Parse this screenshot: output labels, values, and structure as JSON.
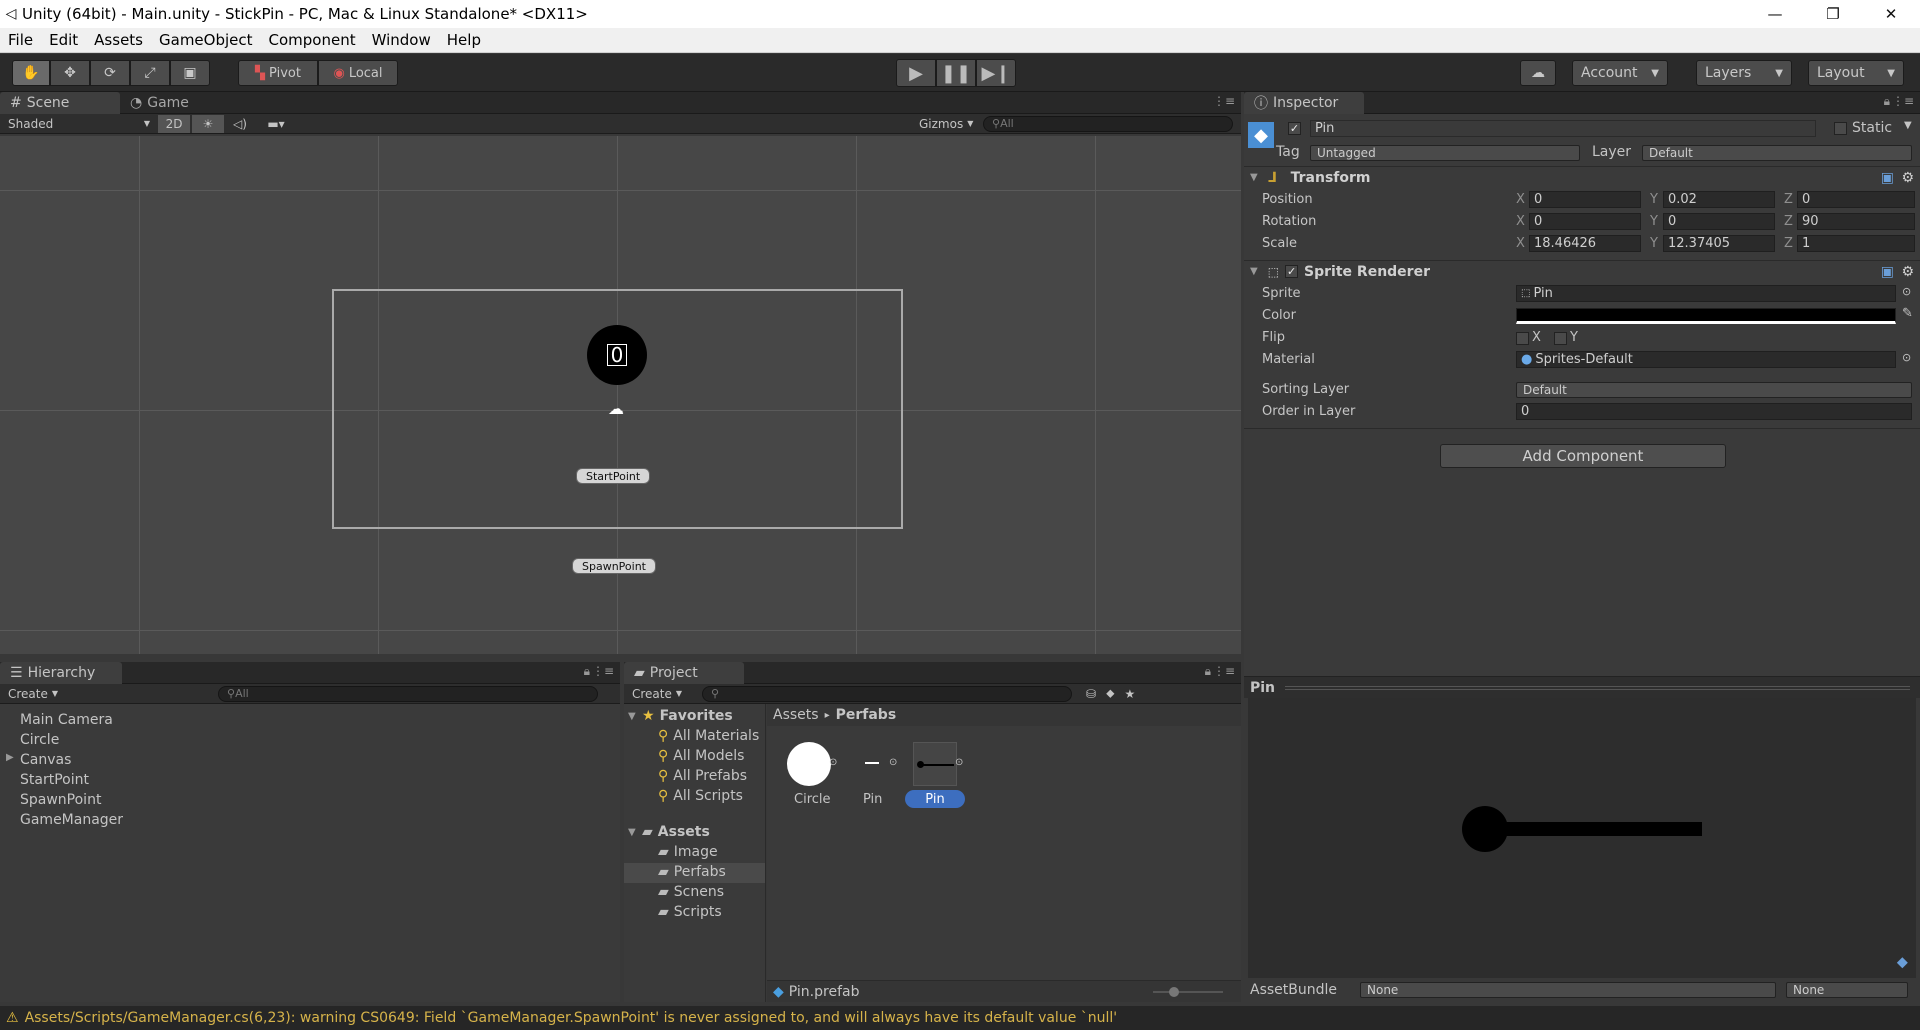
{
  "window": {
    "title": "Unity (64bit) - Main.unity - StickPin - PC, Mac & Linux Standalone* <DX11>",
    "minimize": "—",
    "restore": "❐",
    "close": "✕"
  },
  "menu": [
    "File",
    "Edit",
    "Assets",
    "GameObject",
    "Component",
    "Window",
    "Help"
  ],
  "toolbar": {
    "pivot": "Pivot",
    "local": "Local",
    "account": "Account",
    "layers": "Layers",
    "layout": "Layout"
  },
  "scene_panel": {
    "tabs": [
      "Scene",
      "Game"
    ],
    "shading": "Shaded",
    "mode_2d": "2D",
    "gizmos": "Gizmos",
    "search_placeholder": "All",
    "circle_number": "0",
    "labels": [
      "StartPoint",
      "SpawnPoint"
    ]
  },
  "inspector": {
    "tab": "Inspector",
    "object_name": "Pin",
    "static_label": "Static",
    "tag_label": "Tag",
    "tag_value": "Untagged",
    "layer_label": "Layer",
    "layer_value": "Default",
    "transform": {
      "title": "Transform",
      "rows": [
        {
          "label": "Position",
          "x": "0",
          "y": "0.02",
          "z": "0"
        },
        {
          "label": "Rotation",
          "x": "0",
          "y": "0",
          "z": "90"
        },
        {
          "label": "Scale",
          "x": "18.46426",
          "y": "12.37405",
          "z": "1"
        }
      ],
      "axis": [
        "X",
        "Y",
        "Z"
      ]
    },
    "sprite_renderer": {
      "title": "Sprite Renderer",
      "sprite_label": "Sprite",
      "sprite_value": "Pin",
      "color_label": "Color",
      "color_value": "#000000",
      "flip_label": "Flip",
      "flip_x": "X",
      "flip_y": "Y",
      "material_label": "Material",
      "material_value": "Sprites-Default",
      "sorting_layer_label": "Sorting Layer",
      "sorting_layer_value": "Default",
      "order_label": "Order in Layer",
      "order_value": "0"
    },
    "add_component": "Add Component",
    "preview_title": "Pin",
    "asset_bundle_label": "AssetBundle",
    "asset_bundle_value": "None",
    "asset_bundle_variant": "None"
  },
  "hierarchy": {
    "tab": "Hierarchy",
    "create": "Create",
    "search_placeholder": "All",
    "items": [
      "Main Camera",
      "Circle",
      "Canvas",
      "StartPoint",
      "SpawnPoint",
      "GameManager"
    ]
  },
  "project": {
    "tab": "Project",
    "create": "Create",
    "favorites_title": "Favorites",
    "favorites": [
      "All Materials",
      "All Models",
      "All Prefabs",
      "All Scripts"
    ],
    "assets_title": "Assets",
    "folders": [
      "Image",
      "Perfabs",
      "Scnens",
      "Scripts"
    ],
    "breadcrumb": [
      "Assets",
      "Perfabs"
    ],
    "breadcrumb_sep": "▸",
    "files": [
      "Circle",
      "Pin",
      "Pin"
    ],
    "selected_file": "Pin.prefab"
  },
  "status": {
    "message": "Assets/Scripts/GameManager.cs(6,23): warning CS0649: Field `GameManager.SpawnPoint' is never assigned to, and will always have its default value `null'"
  }
}
